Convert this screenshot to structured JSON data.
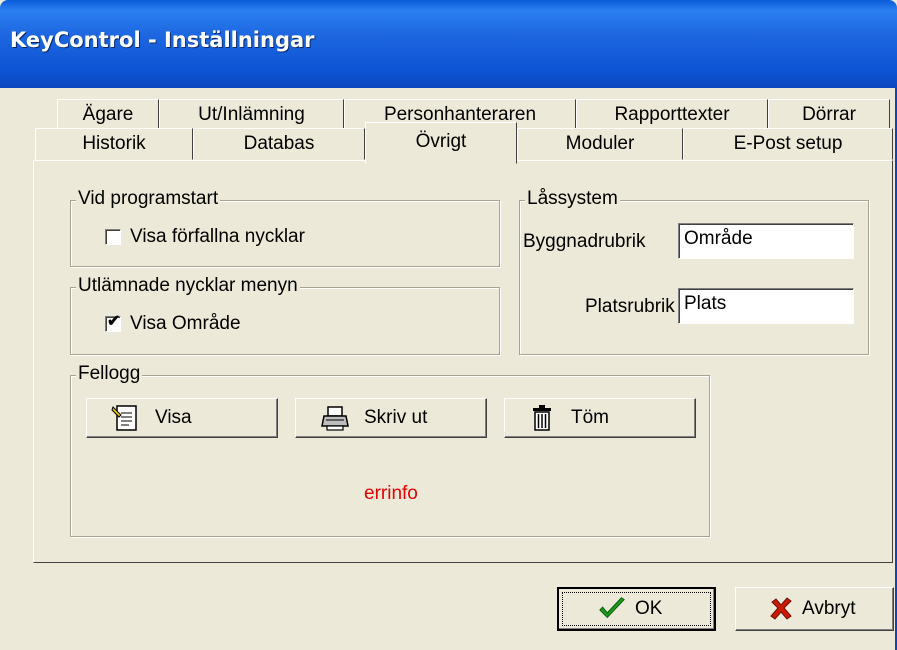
{
  "window": {
    "title": "KeyControl - Inställningar"
  },
  "tabs": {
    "row_back": [
      "Ägare",
      "Ut/Inlämning",
      "Personhanteraren",
      "Rapporttexter",
      "Dörrar"
    ],
    "row_front": [
      "Historik",
      "Databas",
      "Övrigt",
      "Moduler",
      "E-Post setup"
    ],
    "active": "Övrigt"
  },
  "groups": {
    "vid_programstart": {
      "legend": "Vid programstart",
      "checkbox_label": "Visa förfallna nycklar",
      "checked": false
    },
    "utlamnade": {
      "legend": "Utlämnade nycklar menyn",
      "checkbox_label": "Visa Område",
      "checked": true
    },
    "lassystem": {
      "legend": "Låssystem",
      "byggnad_label": "Byggnadrubrik",
      "byggnad_value": "Område",
      "plats_label": "Platsrubrik",
      "plats_value": "Plats"
    },
    "fellogg": {
      "legend": "Fellogg",
      "visa_label": "Visa",
      "skrivut_label": "Skriv ut",
      "tom_label": "Töm",
      "errinfo": "errinfo"
    }
  },
  "footer": {
    "ok_label": "OK",
    "cancel_label": "Avbryt"
  },
  "colors": {
    "titlebar": "#0a5bd8",
    "face": "#ece9d8",
    "error_text": "#e60000",
    "ok_check": "#1a9a1a",
    "cancel_x": "#cc1a00"
  }
}
